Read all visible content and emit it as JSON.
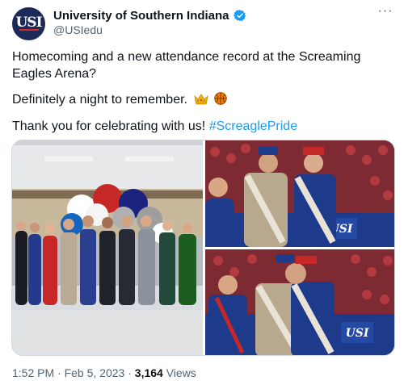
{
  "account": {
    "display_name": "University of Southern Indiana",
    "handle": "@USIedu",
    "avatar_text": "USI",
    "verified": true
  },
  "menu": {
    "more_label": "···"
  },
  "tweet": {
    "line1": "Homecoming and a new attendance record at the Screaming Eagles Arena?",
    "line2": "Definitely a night to remember.",
    "line2_emojis": [
      "crown-icon",
      "basketball-icon"
    ],
    "line3_text": "Thank you for celebrating with us!",
    "hashtag": "#ScreaglePride"
  },
  "media": {
    "photos": [
      {
        "name": "homecoming-court-group-photo",
        "description_icon": "photo"
      },
      {
        "name": "homecoming-kings-crowned-photo",
        "sign_text": "USI"
      },
      {
        "name": "homecoming-kings-hug-photo",
        "sign_text": "USI"
      }
    ]
  },
  "meta": {
    "time": "1:52 PM",
    "separator": "·",
    "date": "Feb 5, 2023",
    "views_count": "3,164",
    "views_label": "Views"
  },
  "colors": {
    "text": "#0f1419",
    "secondary": "#536471",
    "link": "#1d9bf0",
    "verified": "#1d9bf0",
    "usi_navy": "#1b2a56",
    "usi_red": "#d9262e"
  }
}
